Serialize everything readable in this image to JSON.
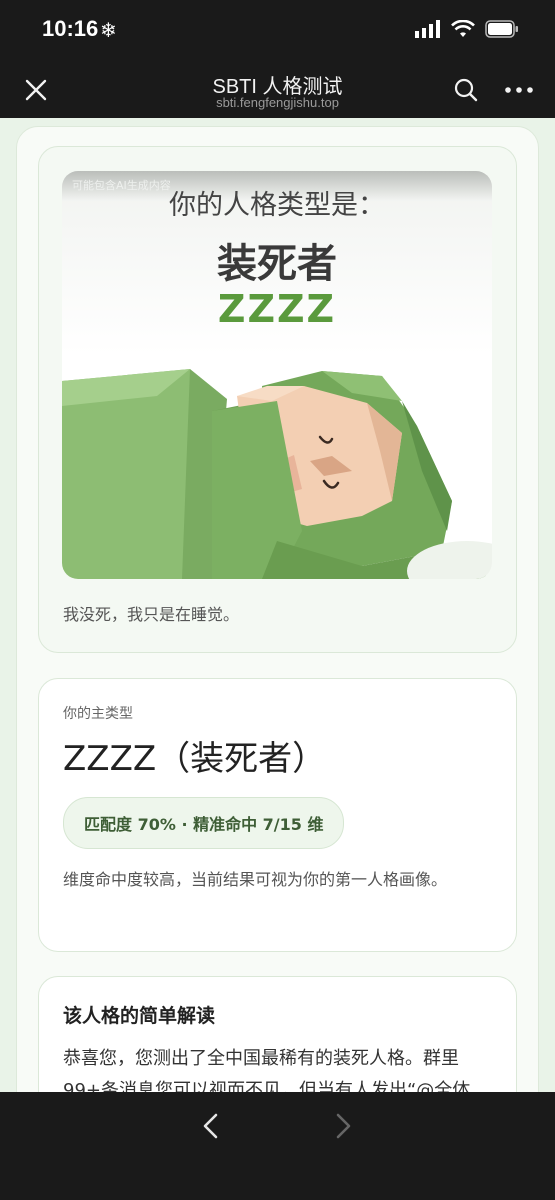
{
  "status": {
    "time": "10:16",
    "extra_icon": "snowflake-icon"
  },
  "nav": {
    "title": "SBTI 人格测试",
    "url": "sbti.fengfengjishu.top"
  },
  "result_card": {
    "watermark": "可能包含AI生成内容",
    "question": "你的人格类型是：",
    "type_name": "装死者",
    "type_code": "ZZZZ",
    "quote": "我没死，我只是在睡觉。"
  },
  "main_type": {
    "label": "你的主类型",
    "title": "ZZZZ（装死者）",
    "match_text": "匹配度 70% · 精准命中 7/15 维",
    "match_percent": 70,
    "dims_hit": 7,
    "dims_total": 15,
    "description": "维度命中度较高，当前结果可视为你的第一人格画像。"
  },
  "interpretation": {
    "title": "该人格的简单解读",
    "body": "恭喜您，您测出了全中国最稀有的装死人格。群里99+条消息您可以视而不见，但当有人发出“@全体"
  },
  "colors": {
    "accent_green": "#5a9a3c",
    "page_bg": "#e9f3e8",
    "chrome_bg": "#1a1a1a"
  }
}
